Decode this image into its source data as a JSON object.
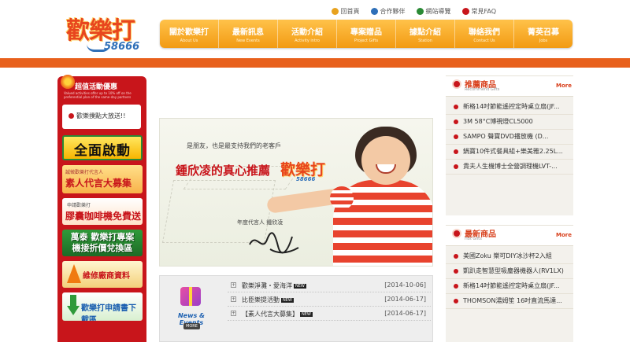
{
  "header": {
    "logo_text": "歡樂打",
    "logo_number": "58666",
    "top_links": [
      {
        "label": "回首頁",
        "icon": "home-icon",
        "color": "#e8a21e"
      },
      {
        "label": "合作夥伴",
        "icon": "partner-icon",
        "color": "#2e6fb8"
      },
      {
        "label": "網站導覽",
        "icon": "sitemap-icon",
        "color": "#2a8a35"
      },
      {
        "label": "常見FAQ",
        "icon": "faq-icon",
        "color": "#c8151b"
      }
    ],
    "nav": [
      {
        "label": "關於歡樂打",
        "sub": "About Us"
      },
      {
        "label": "最新訊息",
        "sub": "New Events"
      },
      {
        "label": "活動介紹",
        "sub": "Activity intro"
      },
      {
        "label": "專案贈品",
        "sub": "Project Gifts"
      },
      {
        "label": "據點介紹",
        "sub": "Station"
      },
      {
        "label": "聯絡我們",
        "sub": "Contact Us"
      },
      {
        "label": "菁英召募",
        "sub": "Jobs"
      }
    ]
  },
  "sidebar": {
    "title": "超值活動優惠",
    "subtitle": "Valued activities offer up to 10% off on the preferential plan of the same-day partners",
    "notice": "歡樂撲點大放送!!",
    "banners": {
      "b1": "全面啟動",
      "b2_small": "誠徵歡樂打代言人",
      "b2_main": "素人代言大募集",
      "b3_small": "申請歡樂打",
      "b3_main": "膠囊咖啡機免費送",
      "b4_line1": "萬泰 歡樂打專案",
      "b4_line2": "機接折價兌換區",
      "b5": "維修廠商資料",
      "b6": "歡樂打申請書下載區"
    }
  },
  "hero": {
    "line1": "是朋友，也是最支持我們的老客戶",
    "line2": "鍾欣凌的真心推薦",
    "logo_text": "歡樂打",
    "logo_number": "58666",
    "spokesperson": "年度代言人  鍾欣凌"
  },
  "news": {
    "badge_label": "News & Events",
    "badge_more": "MORE",
    "items": [
      {
        "title": "歡樂淨灘・愛海洋",
        "date": "[2014-10-06]",
        "tag": "NEW"
      },
      {
        "title": "比臣樂提活動",
        "date": "[2014-06-17]",
        "tag": "NEW"
      },
      {
        "title": "【素人代言大募集】",
        "date": "[2014-06-17]",
        "tag": "NEW"
      }
    ]
  },
  "recommend": {
    "title": "推薦商品",
    "subtitle": "Recommend Gifts",
    "more": "More",
    "items": [
      "新格14吋節能遙控定時桌立扇(JF...",
      "3M 58°C博視燈CL5000",
      "SAMPO 聲寶DVD播放機 (D...",
      "鍋寶10件式餐具組+樂美雅2.25L...",
      "貴夫人生機博士全營調理機LVT-..."
    ]
  },
  "hot": {
    "title": "最新商品",
    "subtitle": "Hot Gifts",
    "more": "More",
    "items": [
      "美國Zoku 樂可DIY冰沙杯2入組",
      "凱趴走智慧型吸塵器機器人(RV1LX)",
      "新格14吋節能遙控定時桌立扇(JF...",
      "THOMSON湯姆笙 16吋直流馬達..."
    ]
  },
  "colors": {
    "accent": "#e8601c",
    "nav": "#f29a12",
    "sidebar": "#c8151b",
    "title_red": "#d8401c"
  }
}
